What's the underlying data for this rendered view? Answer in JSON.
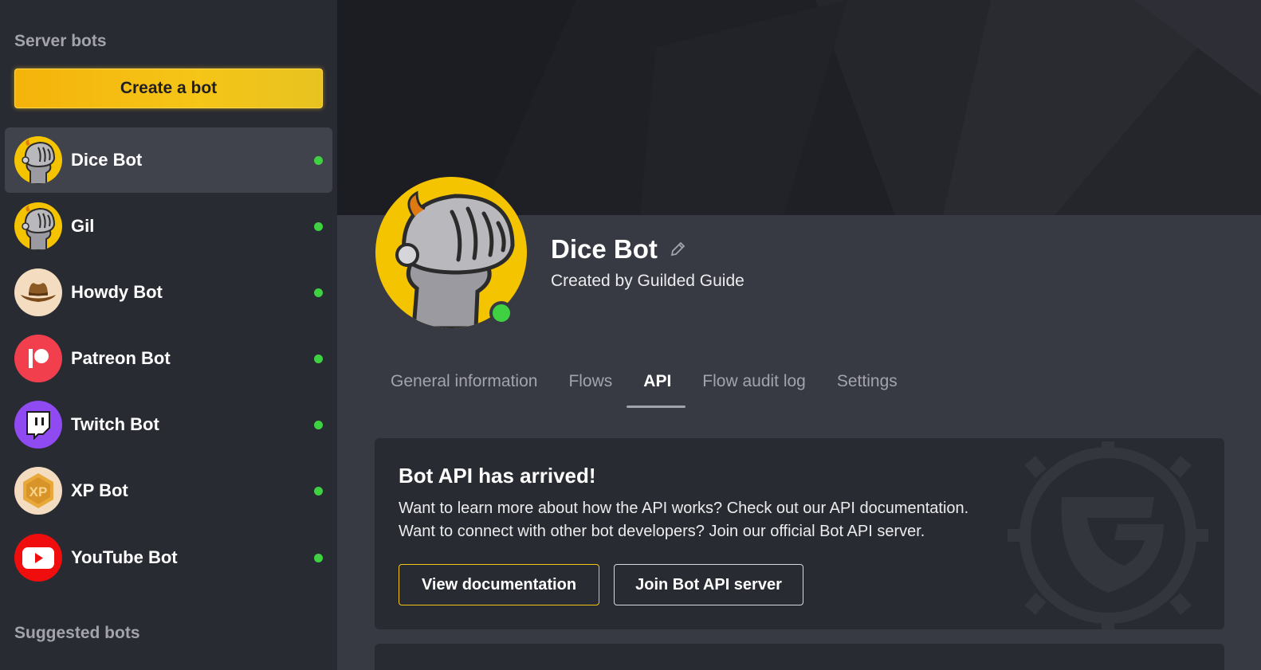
{
  "sidebar": {
    "server_title": "Server bots",
    "create_label": "Create a bot",
    "suggested_title": "Suggested bots",
    "bots": [
      {
        "name": "Dice Bot",
        "icon": "knight-icon",
        "online": true,
        "active": true
      },
      {
        "name": "Gil",
        "icon": "knight-icon",
        "online": true
      },
      {
        "name": "Howdy Bot",
        "icon": "cowboy-hat-icon",
        "online": true
      },
      {
        "name": "Patreon Bot",
        "icon": "patreon-icon",
        "online": true
      },
      {
        "name": "Twitch Bot",
        "icon": "twitch-icon",
        "online": true
      },
      {
        "name": "XP Bot",
        "icon": "xp-icon",
        "online": true
      },
      {
        "name": "YouTube Bot",
        "icon": "youtube-icon",
        "online": true
      }
    ]
  },
  "profile": {
    "name": "Dice Bot",
    "created_by": "Created by Guilded Guide",
    "avatar_icon": "knight-icon",
    "online": true
  },
  "tabs": [
    {
      "label": "General information"
    },
    {
      "label": "Flows"
    },
    {
      "label": "API",
      "active": true
    },
    {
      "label": "Flow audit log"
    },
    {
      "label": "Settings"
    }
  ],
  "api_card": {
    "title": "Bot API has arrived!",
    "line1": "Want to learn more about how the API works? Check out our API documentation.",
    "line2": "Want to connect with other bot developers? Join our official Bot API server.",
    "doc_button": "View documentation",
    "join_button": "Join Bot API server"
  },
  "colors": {
    "accent": "#f5c518",
    "online": "#3fd142",
    "sidebar_bg": "#292b32",
    "main_bg": "#373943"
  }
}
